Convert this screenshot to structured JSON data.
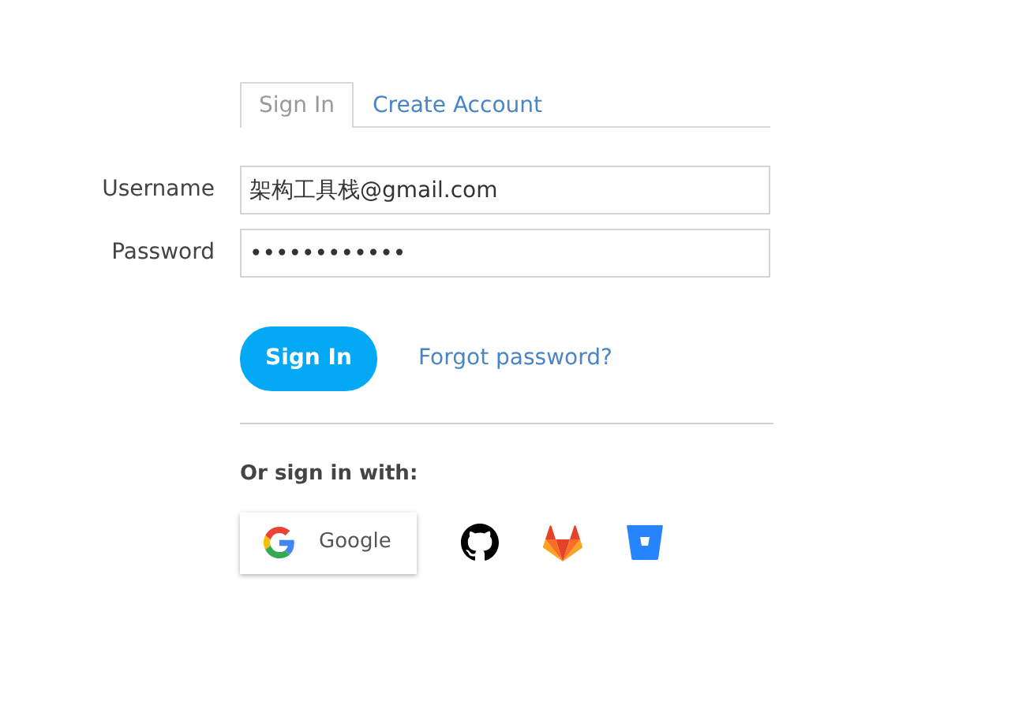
{
  "tabs": [
    {
      "label": "Sign In",
      "selected": true
    },
    {
      "label": "Create Account",
      "selected": false
    }
  ],
  "fields": [
    {
      "label": "Username",
      "value": "架构工具栈@gmail.com"
    },
    {
      "label": "Password",
      "value": "••••••••••••"
    }
  ],
  "submit_button": "Sign In",
  "forgot_link": "Forgot password?",
  "alt_heading": "Or sign in with:",
  "providers": [
    {
      "kind": "labeled",
      "label": "Google"
    },
    {
      "kind": "icon"
    },
    {
      "kind": "icon"
    },
    {
      "kind": "icon"
    }
  ]
}
